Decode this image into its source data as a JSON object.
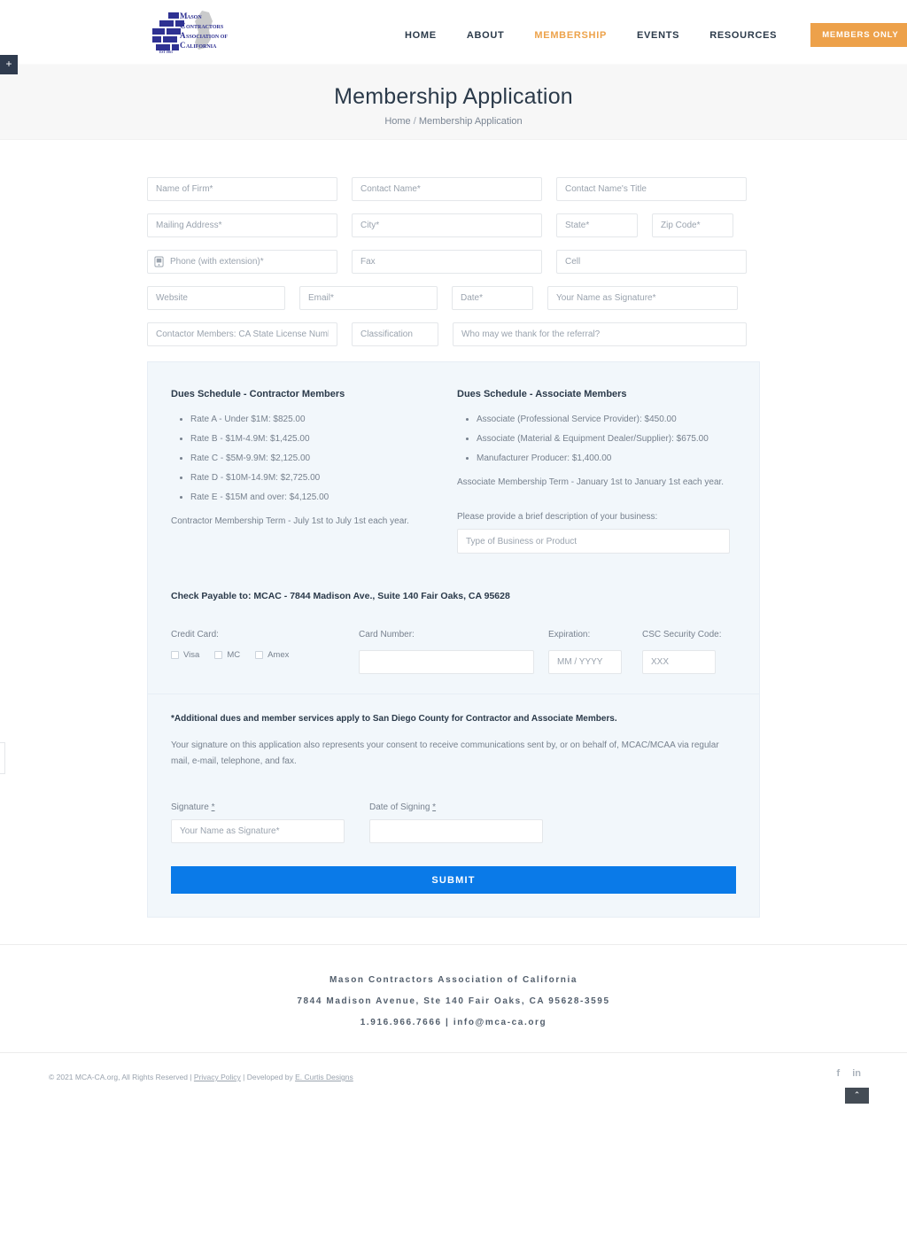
{
  "header": {
    "logo_alt": "Mason Contractors Association of California",
    "logo_lines": [
      "MASON",
      "CONTRACTORS",
      "ASSOCIATION OF",
      "CALIFORNIA"
    ],
    "logo_est": "EST 1963",
    "nav": [
      {
        "label": "HOME",
        "active": false
      },
      {
        "label": "ABOUT",
        "active": false
      },
      {
        "label": "MEMBERSHIP",
        "active": true
      },
      {
        "label": "EVENTS",
        "active": false
      },
      {
        "label": "RESOURCES",
        "active": false
      }
    ],
    "members_only_label": "MEMBERS ONLY",
    "side_toggle_label": "+"
  },
  "title_band": {
    "title": "Membership Application",
    "breadcrumb_home": "Home",
    "breadcrumb_sep": "/",
    "breadcrumb_current": "Membership Application"
  },
  "form": {
    "name_of_firm": "Name of Firm*",
    "contact_name": "Contact Name*",
    "contact_title": "Contact Name's Title",
    "mailing_address": "Mailing Address*",
    "city": "City*",
    "state": "State*",
    "zip_code": "Zip Code*",
    "phone": "Phone (with extension)*",
    "fax": "Fax",
    "cell": "Cell",
    "website": "Website",
    "email": "Email*",
    "date": "Date*",
    "signature_name": "Your Name as Signature*",
    "license": "Contactor Members: CA State License Number",
    "classification": "Classification",
    "referral": "Who may we thank for the referral?"
  },
  "dues": {
    "contractor": {
      "heading": "Dues Schedule - Contractor Members",
      "rates": [
        "Rate A - Under $1M: $825.00",
        "Rate B - $1M-4.9M: $1,425.00",
        "Rate C - $5M-9.9M: $2,125.00",
        "Rate D - $10M-14.9M: $2,725.00",
        "Rate E - $15M and over: $4,125.00"
      ],
      "term": "Contractor Membership Term - July 1st to July 1st each year."
    },
    "associate": {
      "heading": "Dues Schedule - Associate Members",
      "rates": [
        "Associate (Professional Service Provider): $450.00",
        "Associate (Material & Equipment Dealer/Supplier): $675.00",
        "Manufacturer Producer: $1,400.00"
      ],
      "term": "Associate Membership Term - January 1st to January 1st each year.",
      "business_label": "Please provide a brief description of your business:",
      "business_placeholder": "Type of Business or Product"
    },
    "check_payable": "Check Payable to: MCAC - 7844 Madison Ave., Suite 140 Fair Oaks, CA 95628"
  },
  "payment": {
    "credit_card_label": "Credit Card:",
    "options": [
      "Visa",
      "MC",
      "Amex"
    ],
    "card_number_label": "Card Number:",
    "card_number_placeholder": "",
    "expiration_label": "Expiration:",
    "expiration_placeholder": "MM / YYYY",
    "csc_label": "CSC Security Code:",
    "csc_placeholder": "XXX"
  },
  "notice": {
    "bold": "*Additional dues and member services apply to San Diego County for Contractor and Associate Members.",
    "text": "Your signature on this application also represents your consent to receive communications sent by, or on behalf of, MCAC/MCAA via regular mail, e-mail, telephone, and fax."
  },
  "signature": {
    "signature_label": "Signature",
    "signature_required": "*",
    "signature_placeholder": "Your Name as Signature*",
    "date_label": "Date of Signing",
    "date_required": "*",
    "date_placeholder": "",
    "submit_label": "SUBMIT"
  },
  "footer": {
    "org_name": "Mason Contractors Association of California",
    "address": "7844 Madison Avenue, Ste 140 Fair Oaks, CA 95628-3595",
    "contact": "1.916.966.7666 | info@mca-ca.org",
    "copyright": "© 2021 MCA-CA.org, All Rights Reserved  |  ",
    "privacy_policy": "Privacy Policy",
    "developed_sep": "  |  Developed by ",
    "developer": "E. Curtis Designs",
    "social": [
      "facebook-icon",
      "linkedin-icon"
    ],
    "to_top": "⌃"
  },
  "colors": {
    "accent_orange": "#eda14a",
    "submit_blue": "#0a7ae8",
    "panel_bg": "#f2f7fb",
    "title_band_bg": "#f7f7f7",
    "dark_text": "#2b3a4a"
  }
}
